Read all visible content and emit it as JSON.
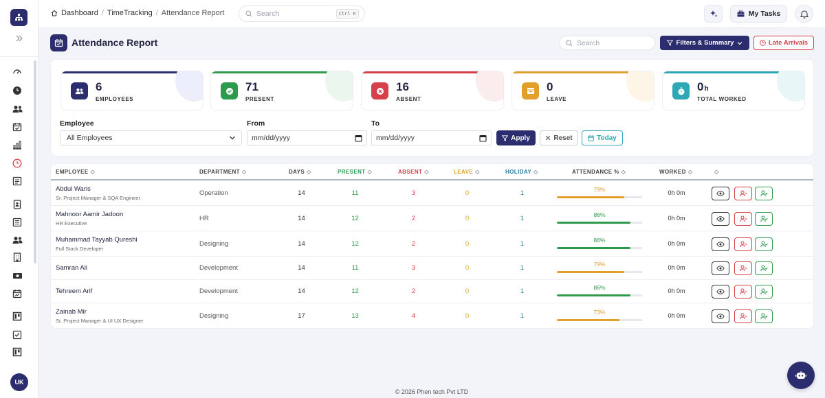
{
  "breadcrumb": [
    "Dashboard",
    "TimeTracking",
    "Attendance Report"
  ],
  "header": {
    "search_placeholder": "Search",
    "search_shortcut": "Ctrl K",
    "my_tasks_label": "My Tasks"
  },
  "page": {
    "title": "Attendance Report",
    "search_placeholder": "Search",
    "filters_label": "Filters & Summary",
    "late_label": "Late Arrivals"
  },
  "summary": [
    {
      "value": "6",
      "unit": "",
      "label": "EMPLOYEES",
      "color": "#2b2d6e",
      "icon": "users-icon"
    },
    {
      "value": "71",
      "unit": "",
      "label": "PRESENT",
      "color": "#2e9a4e",
      "icon": "check-circle-icon"
    },
    {
      "value": "16",
      "unit": "",
      "label": "ABSENT",
      "color": "#d6404a",
      "icon": "x-circle-icon"
    },
    {
      "value": "0",
      "unit": "",
      "label": "LEAVE",
      "color": "#e0a02a",
      "icon": "leave-icon"
    },
    {
      "value": "0",
      "unit": "h",
      "label": "TOTAL WORKED",
      "color": "#2fa8b5",
      "icon": "stopwatch-icon"
    }
  ],
  "filters": {
    "employee_label": "Employee",
    "employee_value": "All Employees",
    "from_label": "From",
    "from_value": "mm/dd/yyyy",
    "to_label": "To",
    "to_value": "mm/dd/yyyy",
    "apply_label": "Apply",
    "reset_label": "Reset",
    "today_label": "Today"
  },
  "table": {
    "columns": [
      "EMPLOYEE",
      "DEPARTMENT",
      "DAYS",
      "PRESENT",
      "ABSENT",
      "LEAVE",
      "HOLIDAY",
      "ATTENDANCE %",
      "WORKED",
      ""
    ],
    "rows": [
      {
        "name": "Abdul Waris",
        "title": "Sr. Project Manager & SQA Engineer",
        "department": "Operation",
        "days": "14",
        "present": "11",
        "absent": "3",
        "leave": "0",
        "holiday": "1",
        "attendance": "79%",
        "attendance_value": 79,
        "worked": "0h 0m"
      },
      {
        "name": "Mahnoor Aamir Jadoon",
        "title": "HR Executive",
        "department": "HR",
        "days": "14",
        "present": "12",
        "absent": "2",
        "leave": "0",
        "holiday": "1",
        "attendance": "86%",
        "attendance_value": 86,
        "worked": "0h 0m"
      },
      {
        "name": "Muhammad Tayyab Qureshi",
        "title": "Full Stack Developer",
        "department": "Designing",
        "days": "14",
        "present": "12",
        "absent": "2",
        "leave": "0",
        "holiday": "1",
        "attendance": "86%",
        "attendance_value": 86,
        "worked": "0h 0m"
      },
      {
        "name": "Samran Ali",
        "title": "",
        "department": "Development",
        "days": "14",
        "present": "11",
        "absent": "3",
        "leave": "0",
        "holiday": "1",
        "attendance": "79%",
        "attendance_value": 79,
        "worked": "0h 0m"
      },
      {
        "name": "Tehreem Arif",
        "title": "",
        "department": "Development",
        "days": "14",
        "present": "12",
        "absent": "2",
        "leave": "0",
        "holiday": "1",
        "attendance": "86%",
        "attendance_value": 86,
        "worked": "0h 0m"
      },
      {
        "name": "Zainab Mir",
        "title": "Sr. Project Manager & UI UX Designer",
        "department": "Designing",
        "days": "17",
        "present": "13",
        "absent": "4",
        "leave": "0",
        "holiday": "1",
        "attendance": "73%",
        "attendance_value": 73,
        "worked": "0h 0m"
      }
    ]
  },
  "colors": {
    "primary": "#2b2d6e",
    "present": "#2e9a4e",
    "absent": "#d6404a",
    "leave": "#e0a02a",
    "holiday": "#2e7fa3",
    "teal": "#2fa8b5"
  },
  "user_initials": "UK",
  "footer": "© 2026 Phen tech Pvt LTD"
}
